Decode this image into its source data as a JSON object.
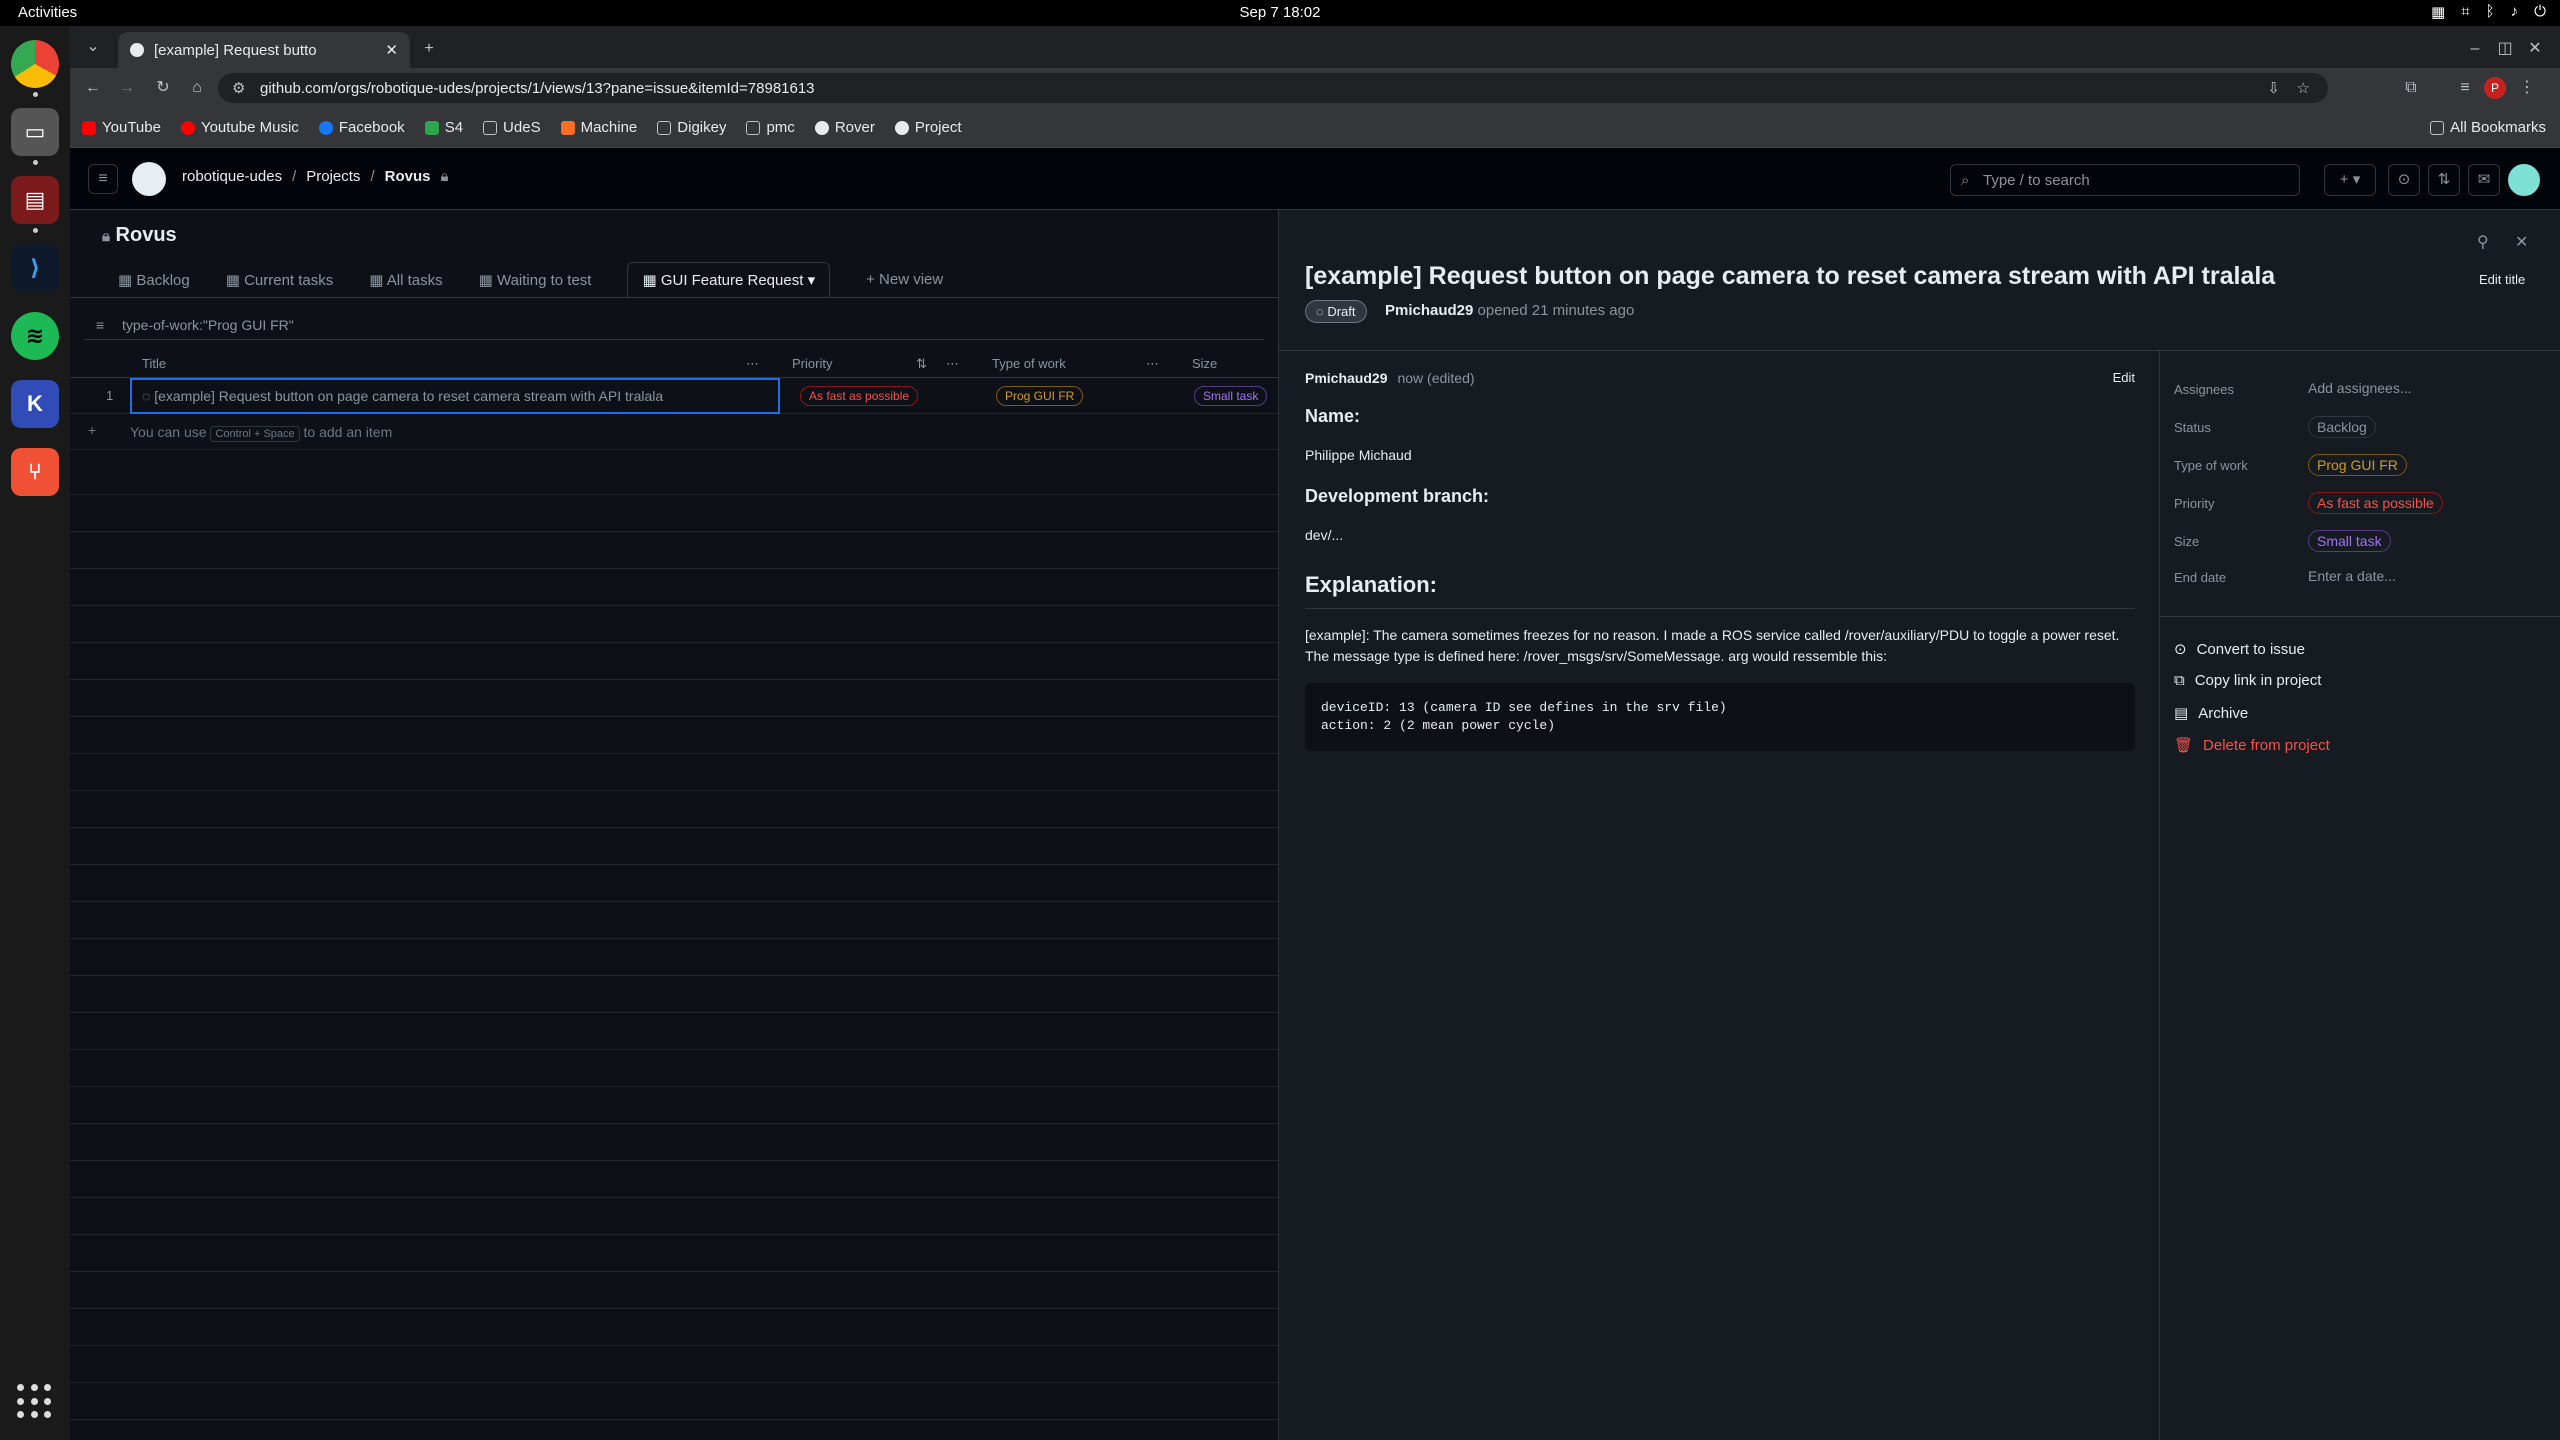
{
  "os": {
    "activities": "Activities",
    "clock": "Sep 7  18:02",
    "tray_icons": [
      "grid-icon",
      "network-icon",
      "bluetooth-icon",
      "volume-icon",
      "power-icon"
    ]
  },
  "dock": {
    "apps": [
      "chrome",
      "files",
      "terminal",
      "vscode",
      "spotify",
      "kicad",
      "git-app"
    ]
  },
  "browser": {
    "tab_title": "[example] Request butto",
    "url": "github.com/orgs/robotique-udes/projects/1/views/13?pane=issue&itemId=78981613",
    "bookmarks": [
      "YouTube",
      "Youtube Music",
      "Facebook",
      "S4",
      "UdeS",
      "Machine",
      "Digikey",
      "pmc",
      "Rover",
      "Project"
    ],
    "all_bookmarks": "All Bookmarks",
    "profile_initial": "P"
  },
  "github": {
    "org": "robotique-udes",
    "projects": "Projects",
    "project_name": "Rovus",
    "search_placeholder": "Type / to search"
  },
  "project": {
    "title": "Rovus",
    "views": [
      "Backlog",
      "Current tasks",
      "All tasks",
      "Waiting to test",
      "GUI Feature Request"
    ],
    "new_view": "New view",
    "filter": "type-of-work:\"Prog GUI FR\"",
    "columns": [
      "Title",
      "Priority",
      "Type of work",
      "Size"
    ],
    "rows": [
      {
        "num": "1",
        "title": "[example] Request button on page camera to reset camera stream with API tralala",
        "priority": "As fast as possible",
        "type": "Prog GUI FR",
        "size": "Small task"
      }
    ],
    "add_hint_prefix": "You can use",
    "add_hint_key": "Control + Space",
    "add_hint_suffix": "to add an item"
  },
  "panel": {
    "title": "[example] Request button on page camera to reset camera stream with API tralala",
    "draft": "Draft",
    "author": "Pmichaud29",
    "opened": "opened 21 minutes ago",
    "edit_title": "Edit title",
    "comment_author": "Pmichaud29",
    "comment_time": "now (edited)",
    "edit": "Edit",
    "h_name": "Name:",
    "name": "Philippe Michaud",
    "h_branch": "Development branch:",
    "branch": "dev/...",
    "h_explanation": "Explanation:",
    "explanation": "[example]: The camera sometimes freezes for no reason. I made a ROS service called /rover/auxiliary/PDU to toggle a power reset. The message type is defined here: /rover_msgs/srv/SomeMessage. arg would ressemble this:",
    "code_line1": "deviceID: 13 (camera ID see defines in the srv file)",
    "code_line2": "action: 2 (2 mean power cycle)",
    "fields": {
      "assignees_label": "Assignees",
      "assignees_value": "Add assignees...",
      "status_label": "Status",
      "status_value": "Backlog",
      "type_label": "Type of work",
      "type_value": "Prog GUI FR",
      "priority_label": "Priority",
      "priority_value": "As fast as possible",
      "size_label": "Size",
      "size_value": "Small task",
      "end_label": "End date",
      "end_value": "Enter a date..."
    },
    "actions": {
      "convert": "Convert to issue",
      "copy": "Copy link in project",
      "archive": "Archive",
      "delete": "Delete from project"
    }
  },
  "colors": {
    "priority": "#f85149",
    "type": "#d29922",
    "size": "#a371f7",
    "accent": "#1f6feb"
  }
}
